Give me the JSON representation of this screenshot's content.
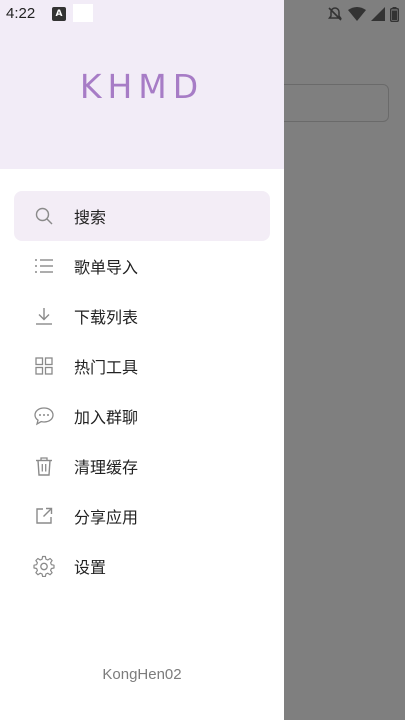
{
  "status_bar": {
    "time": "4:22",
    "notification_icon_letter": "A"
  },
  "drawer": {
    "title": "KHMD",
    "accent_color": "#a77cc6",
    "header_color": "#f2ecf7",
    "items": [
      {
        "label": "搜索",
        "icon": "search-icon",
        "active": true
      },
      {
        "label": "歌单导入",
        "icon": "list-icon",
        "active": false
      },
      {
        "label": "下载列表",
        "icon": "download-icon",
        "active": false
      },
      {
        "label": "热门工具",
        "icon": "grid-icon",
        "active": false
      },
      {
        "label": "加入群聊",
        "icon": "chat-icon",
        "active": false
      },
      {
        "label": "清理缓存",
        "icon": "trash-icon",
        "active": false
      },
      {
        "label": "分享应用",
        "icon": "share-icon",
        "active": false
      },
      {
        "label": "设置",
        "icon": "gear-icon",
        "active": false
      }
    ],
    "footer": "KongHen02"
  }
}
